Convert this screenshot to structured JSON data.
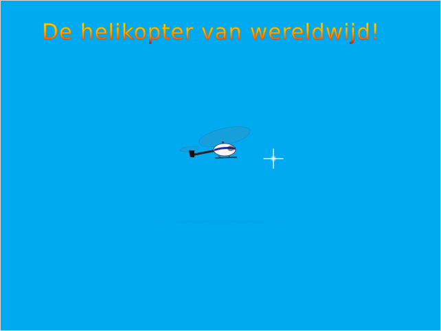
{
  "game": {
    "title": "De helikopter van wereldwijd!",
    "background_color": "#00AAF0",
    "title_gradient": [
      "#f7e100",
      "#ffb400",
      "#ff6a00",
      "#d10000"
    ]
  },
  "sprites": {
    "player": "helicopter-icon",
    "cursor": "crosshair-icon"
  }
}
